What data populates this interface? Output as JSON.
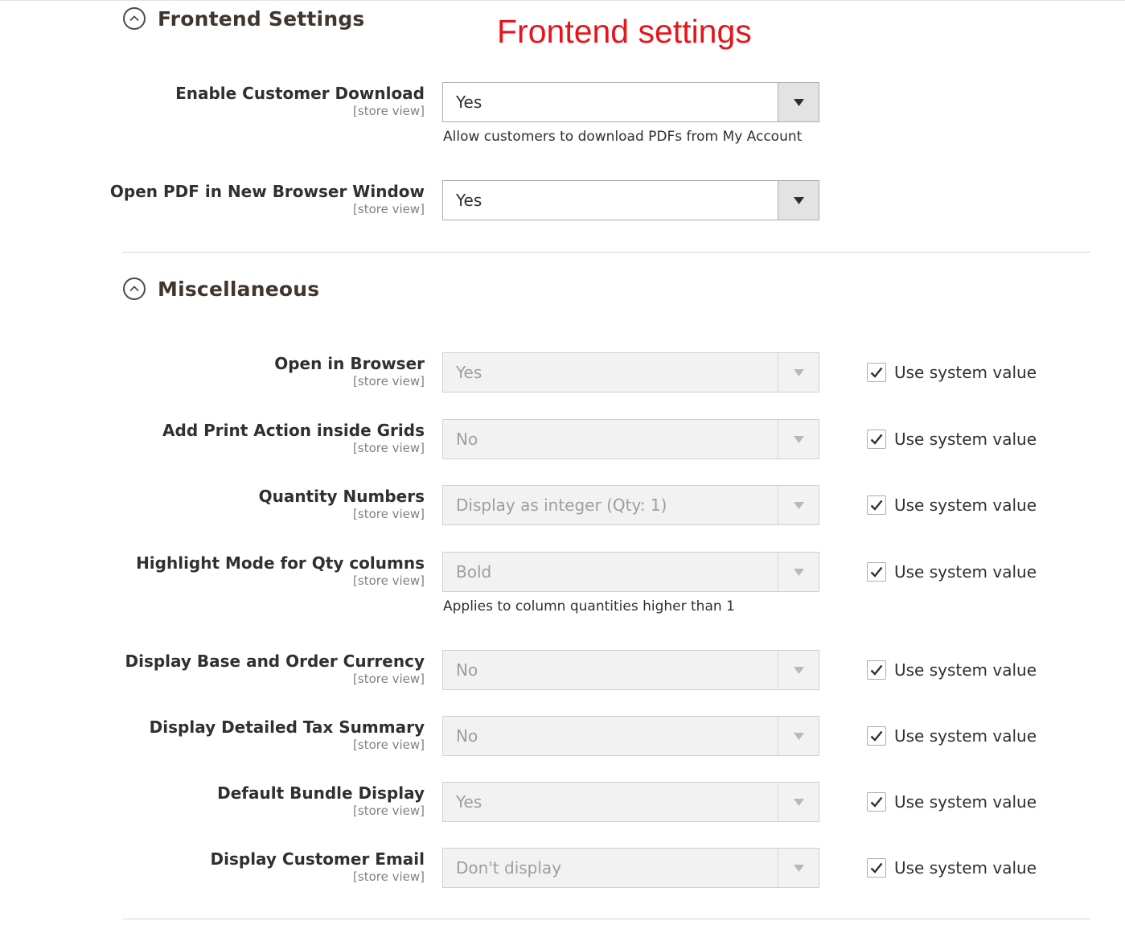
{
  "annotation": "Frontend settings",
  "colors": {
    "annotation": "#e8141b",
    "text": "#303030",
    "scope": "#808080",
    "disabled_text": "#9e9e9e",
    "disabled_bg": "#f2f2f2",
    "arrow_bg": "#e3e3e3"
  },
  "icons": {
    "collapse": "chevron-up-circle-icon",
    "dropdown": "caret-down-icon",
    "check": "checkmark-icon"
  },
  "frontend": {
    "title": "Frontend Settings",
    "fields": [
      {
        "label": "Enable Customer Download",
        "scope": "[store view]",
        "value": "Yes",
        "note": "Allow customers to download PDFs from My Account"
      },
      {
        "label": "Open PDF in New Browser Window",
        "scope": "[store view]",
        "value": "Yes"
      }
    ]
  },
  "misc": {
    "title": "Miscellaneous",
    "use_system_label": "Use system value",
    "fields": [
      {
        "label": "Open in Browser",
        "scope": "[store view]",
        "value": "Yes",
        "use_system": true
      },
      {
        "label": "Add Print Action inside Grids",
        "scope": "[store view]",
        "value": "No",
        "use_system": true
      },
      {
        "label": "Quantity Numbers",
        "scope": "[store view]",
        "value": "Display as integer (Qty: 1)",
        "use_system": true
      },
      {
        "label": "Highlight Mode for Qty columns",
        "scope": "[store view]",
        "value": "Bold",
        "note": "Applies to column quantities higher than 1",
        "use_system": true
      },
      {
        "label": "Display Base and Order Currency",
        "scope": "[store view]",
        "value": "No",
        "use_system": true
      },
      {
        "label": "Display Detailed Tax Summary",
        "scope": "[store view]",
        "value": "No",
        "use_system": true
      },
      {
        "label": "Default Bundle Display",
        "scope": "[store view]",
        "value": "Yes",
        "use_system": true
      },
      {
        "label": "Display Customer Email",
        "scope": "[store view]",
        "value": "Don't display",
        "use_system": true
      }
    ]
  }
}
